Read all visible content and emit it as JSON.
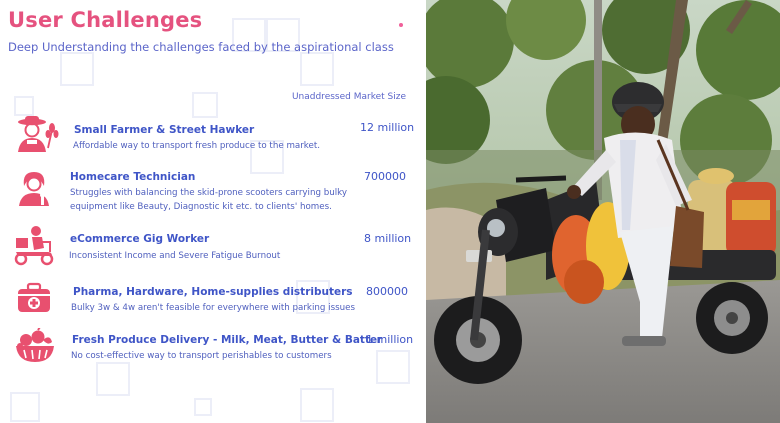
{
  "slide": {
    "title": "User Challenges",
    "subtitle": "Deep Understanding the challenges faced by the aspirational class",
    "market_size_header": "Unaddressed Market Size"
  },
  "challenges": [
    {
      "icon": "farmer-icon",
      "title": "Small Farmer & Street Hawker",
      "description": "Affordable way to transport fresh produce to the market.",
      "market_size": "12 million"
    },
    {
      "icon": "beautician-icon",
      "title": "Homecare Technician",
      "description_line1": "Struggles with balancing the skid-prone scooters carrying bulky",
      "description_line2": "equipment like Beauty, Diagnostic kit etc. to clients' homes.",
      "market_size": "700000"
    },
    {
      "icon": "delivery-scooter-icon",
      "title": "eCommerce Gig Worker",
      "description": "Inconsistent Income and Severe Fatigue Burnout",
      "market_size": "8 million"
    },
    {
      "icon": "medical-kit-icon",
      "title": "Pharma, Hardware, Home-supplies distributers",
      "description": "Bulky 3w & 4w aren't feasible for everywhere with parking issues",
      "market_size": "800000"
    },
    {
      "icon": "fruit-basket-icon",
      "title": "Fresh Produce Delivery - Milk, Meat, Butter & Batter",
      "description": "No cost-effective way to transport perishables to customers",
      "market_size": "1 million"
    }
  ],
  "colors": {
    "title": "#e5527f",
    "accent_blue": "#3f55c7",
    "icon": "#e8506f"
  }
}
